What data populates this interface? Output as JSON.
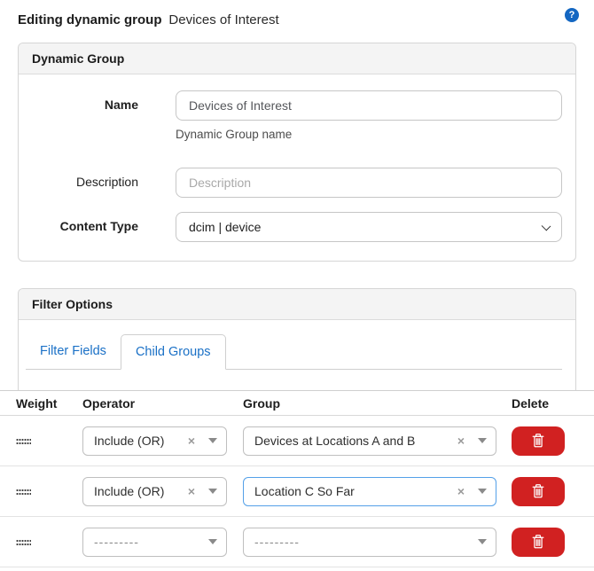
{
  "header": {
    "title_prefix": "Editing dynamic group",
    "title_name": "Devices of Interest",
    "help_glyph": "?"
  },
  "dynamic_group": {
    "panel_title": "Dynamic Group",
    "name_label": "Name",
    "name_value": "Devices of Interest",
    "name_help": "Dynamic Group name",
    "description_label": "Description",
    "description_placeholder": "Description",
    "content_type_label": "Content Type",
    "content_type_value": "dcim | device"
  },
  "filter_options": {
    "panel_title": "Filter Options",
    "tabs": [
      {
        "label": "Filter Fields",
        "active": false
      },
      {
        "label": "Child Groups",
        "active": true
      }
    ]
  },
  "child_groups": {
    "columns": {
      "weight": "Weight",
      "operator": "Operator",
      "group": "Group",
      "delete": "Delete"
    },
    "clear_glyph": "×",
    "rows": [
      {
        "operator": "Include (OR)",
        "group": "Devices at Locations A and B",
        "clearable": true,
        "focused": false
      },
      {
        "operator": "Include (OR)",
        "group": "Location C So Far",
        "clearable": true,
        "focused": true
      },
      {
        "operator": "---------",
        "group": "---------",
        "clearable": false,
        "focused": false
      }
    ]
  },
  "colors": {
    "accent_blue": "#1a70c6",
    "help_blue": "#1467c2",
    "focus_blue": "#54a0e8",
    "danger_red": "#d12121",
    "panel_header_bg": "#f4f4f4"
  }
}
